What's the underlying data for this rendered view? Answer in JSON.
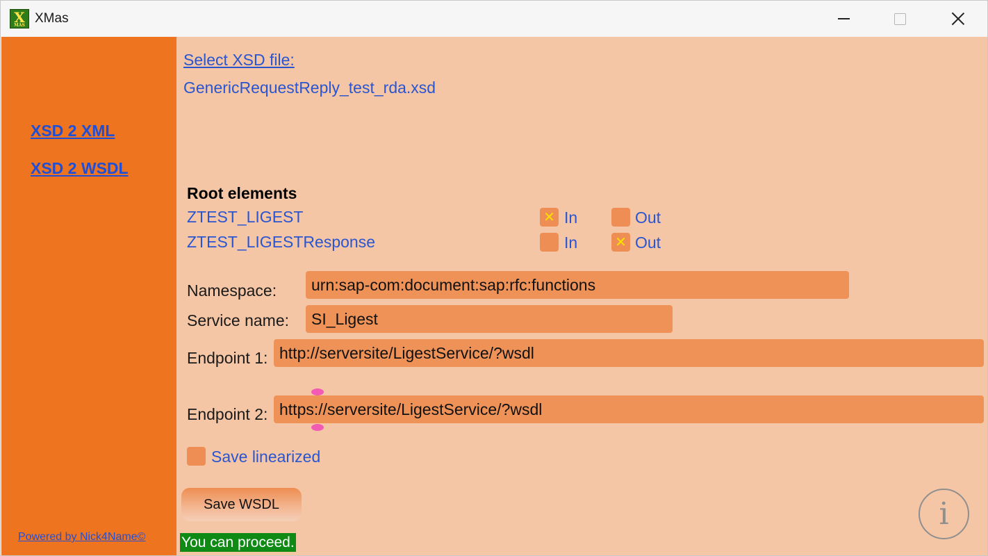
{
  "window": {
    "title": "XMas",
    "icon_letter": "X",
    "icon_caption": "MAS"
  },
  "sidebar": {
    "links": [
      "XSD 2 XML",
      "XSD 2 WSDL"
    ],
    "footer": "Powered by Nick4Name©"
  },
  "main": {
    "select_xsd_label": "Select XSD file:",
    "selected_file": "GenericRequestReply_test_rda.xsd",
    "root_elements_heading": "Root elements",
    "root_elements": [
      {
        "name": "ZTEST_LIGEST",
        "in_label": "In",
        "out_label": "Out",
        "in": true,
        "out": false
      },
      {
        "name": "ZTEST_LIGESTResponse",
        "in_label": "In",
        "out_label": "Out",
        "in": false,
        "out": true
      }
    ],
    "fields": {
      "namespace_label": "Namespace:",
      "namespace_value": "urn:sap-com:document:sap:rfc:functions",
      "service_label": "Service name:",
      "service_value": "SI_Ligest",
      "endpoint1_label": "Endpoint 1:",
      "endpoint1_value": "http://serversite/LigestService/?wsdl",
      "endpoint2_label": "Endpoint 2:",
      "endpoint2_value": "https://serversite/LigestService/?wsdl"
    },
    "save_linearized_label": "Save linearized",
    "save_linearized_checked": false,
    "save_button": "Save WSDL",
    "status_text": "You can proceed.",
    "info_icon": "i"
  },
  "colors": {
    "sidebar": "#ee7420",
    "content": "#f5c6a5",
    "input": "#ee9258",
    "link": "#2a55d0",
    "status_bg": "#0f8a14",
    "check_mark": "#ffe000"
  }
}
